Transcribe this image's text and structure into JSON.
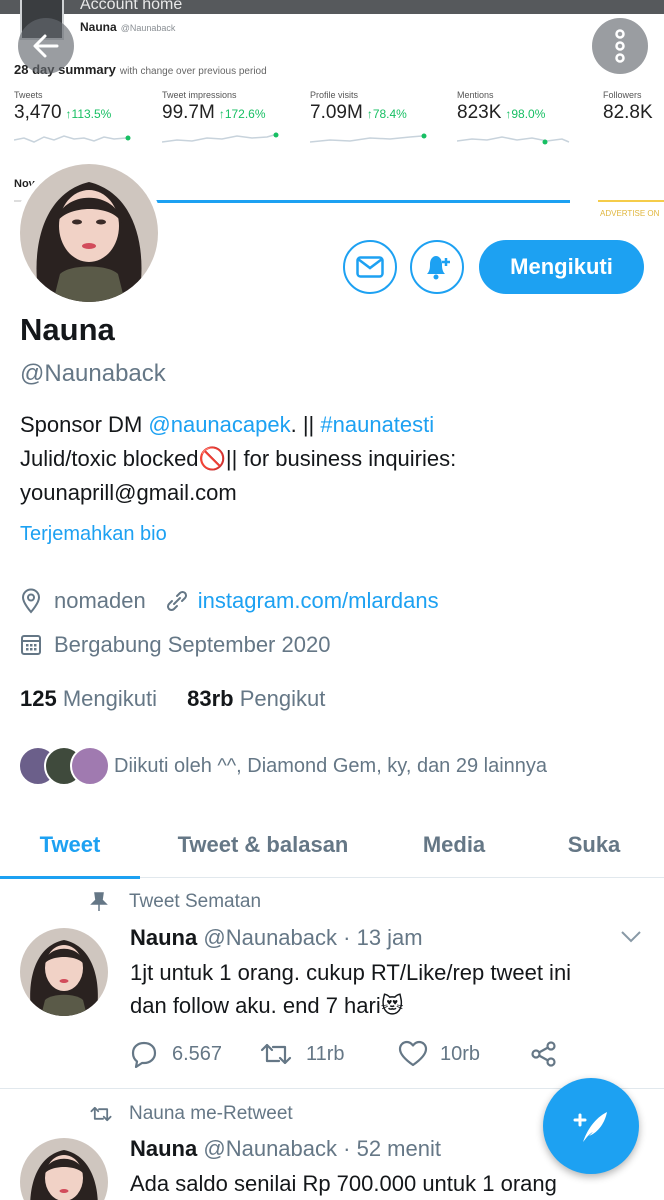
{
  "banner": {
    "window_title": "Account home",
    "account_name": "Nauna",
    "account_handle": "@Naunaback",
    "summary_title": "28 day summary",
    "summary_sub": "with change over previous period",
    "metrics": [
      {
        "label": "Tweets",
        "value": "3,470",
        "change": "113.5%"
      },
      {
        "label": "Tweet impressions",
        "value": "99.7M",
        "change": "172.6%"
      },
      {
        "label": "Profile visits",
        "value": "7.09M",
        "change": "78.4%"
      },
      {
        "label": "Mentions",
        "value": "823K",
        "change": "98.0%"
      },
      {
        "label": "Followers",
        "value": "82.8K",
        "change": ""
      }
    ],
    "month_label": "Nov",
    "advertise_label": "ADVERTISE ON"
  },
  "profile": {
    "name": "Nauna",
    "handle": "@Naunaback",
    "follow_label": "Mengikuti",
    "bio_line1_prefix": "Sponsor DM ",
    "bio_mention": "@naunacapek",
    "bio_line1_mid": ". || ",
    "bio_hashtag": "#naunatesti",
    "bio_line2": "Julid/toxic blocked🚫|| for business inquiries:",
    "bio_line3": "younaprill@gmail.com",
    "translate_label": "Terjemahkan bio",
    "location": "nomaden",
    "website": "instagram.com/mlardans",
    "joined": "Bergabung September 2020",
    "following_count": "125",
    "following_label": "Mengikuti",
    "followers_count": "83rb",
    "followers_label": "Pengikut",
    "followed_by": "Diikuti oleh ^^, Diamond Gem, ky, dan 29 lainnya"
  },
  "tabs": [
    "Tweet",
    "Tweet & balasan",
    "Media",
    "Suka"
  ],
  "tweets": [
    {
      "context": "Tweet Sematan",
      "name": "Nauna",
      "handle": "@Naunaback",
      "time": "· 13 jam",
      "text_line1": "1jt untuk 1 orang. cukup RT/Like/rep tweet ini",
      "text_line2": "dan follow aku. end 7 hari😻",
      "replies": "6.567",
      "retweets": "11rb",
      "likes": "10rb"
    },
    {
      "context": "Nauna me-Retweet",
      "name": "Nauna",
      "handle": "@Naunaback",
      "time": "· 52 menit",
      "text_line1": "Ada saldo senilai Rp 700.000 untuk 1 orang"
    }
  ],
  "colors": {
    "accent": "#1da1f2",
    "text": "#14171a",
    "muted": "#657786",
    "green": "#17bf63"
  }
}
